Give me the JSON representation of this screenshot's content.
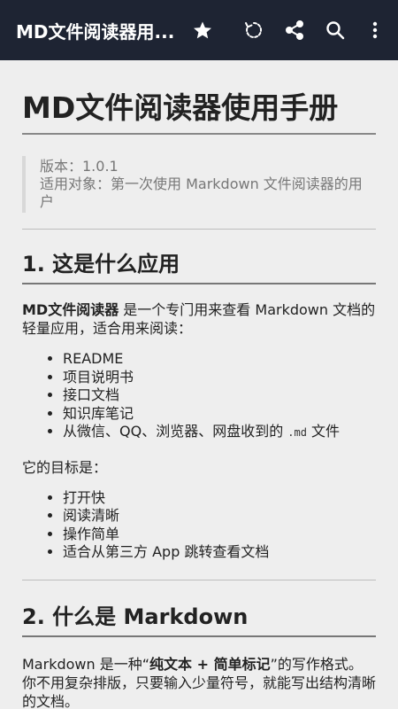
{
  "appbar": {
    "title": "MD文件阅读器用...",
    "icons": [
      "star-icon",
      "rotate-icon",
      "share-icon",
      "search-icon",
      "more-vert-icon"
    ]
  },
  "doc": {
    "h1": "MD文件阅读器使用手册",
    "quote_line1": "版本：1.0.1",
    "quote_line2": "适用对象：第一次使用 Markdown 文件阅读器的用户",
    "sec1_title": "1. 这是什么应用",
    "sec1_intro_bold": "MD文件阅读器",
    "sec1_intro_rest": " 是一个专门用来查看 Markdown 文档的轻量应用，适合用来阅读：",
    "sec1_list": [
      "README",
      "项目说明书",
      "接口文档",
      "知识库笔记"
    ],
    "sec1_list_last_pre": "从微信、QQ、浏览器、网盘收到的 ",
    "sec1_list_last_code": ".md",
    "sec1_list_last_post": " 文件",
    "sec1_goal": "它的目标是：",
    "sec1_goals": [
      "打开快",
      "阅读清晰",
      "操作简单",
      "适合从第三方 App 跳转查看文档"
    ],
    "sec2_title": "2. 什么是 Markdown",
    "sec2_pre": "Markdown 是一种“",
    "sec2_bold": "纯文本 + 简单标记",
    "sec2_post": "”的写作格式。你不用复杂排版，只要输入少量符号，就能写出结构清晰的文档。"
  },
  "colors": {
    "appbar_bg": "#1e2433",
    "page_bg": "#eeeeee",
    "quote_text": "#777777"
  }
}
